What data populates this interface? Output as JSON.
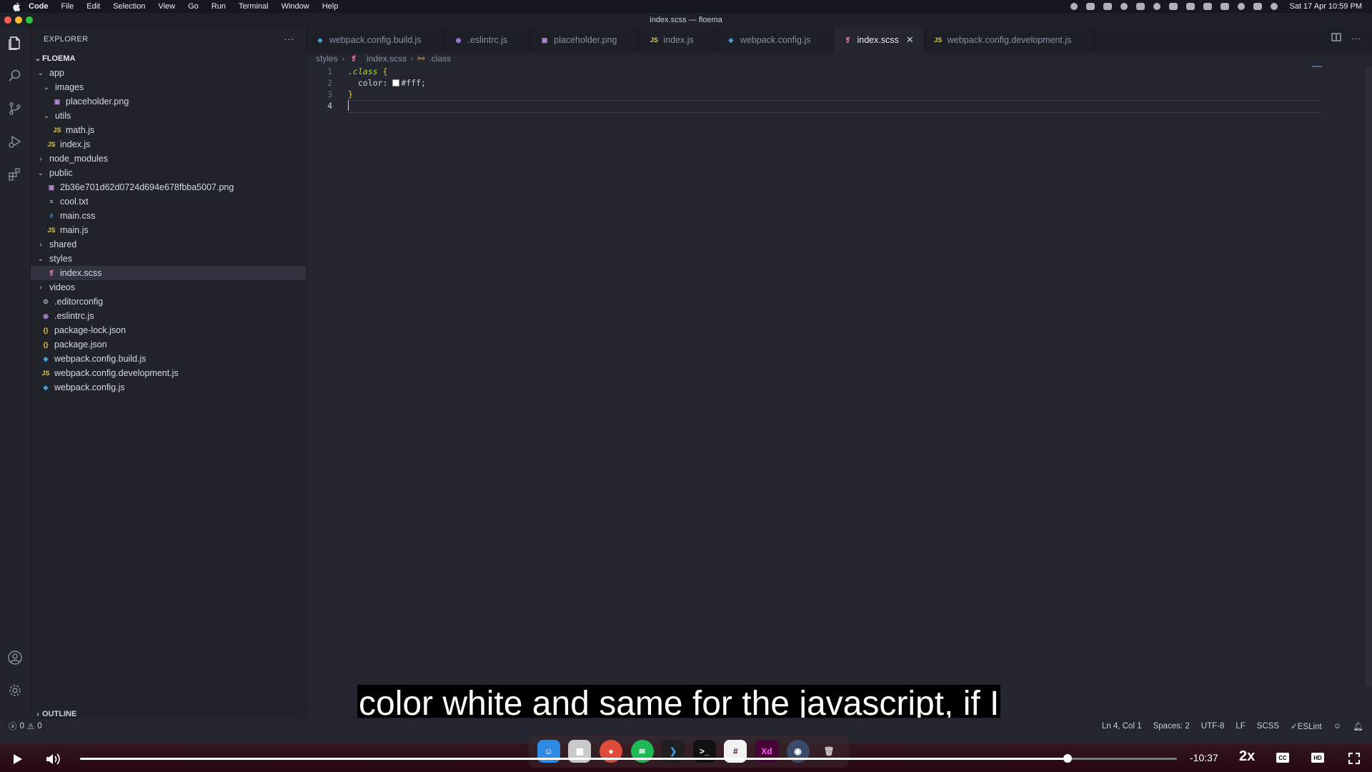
{
  "menubar": {
    "items": [
      "Code",
      "File",
      "Edit",
      "Selection",
      "View",
      "Go",
      "Run",
      "Terminal",
      "Window",
      "Help"
    ],
    "datetime": "Sat 17 Apr  10:59 PM"
  },
  "window": {
    "title": "index.scss — floema"
  },
  "sidebar": {
    "title": "EXPLORER",
    "more": "···",
    "root": "FLOEMA",
    "outline": "OUTLINE",
    "tree": [
      {
        "label": "app",
        "type": "folder",
        "open": true,
        "depth": 0
      },
      {
        "label": "images",
        "type": "folder",
        "open": true,
        "depth": 1
      },
      {
        "label": "placeholder.png",
        "type": "img",
        "depth": 2
      },
      {
        "label": "utils",
        "type": "folder",
        "open": true,
        "depth": 1
      },
      {
        "label": "math.js",
        "type": "js",
        "depth": 2
      },
      {
        "label": "index.js",
        "type": "js",
        "depth": 1
      },
      {
        "label": "node_modules",
        "type": "folder",
        "open": false,
        "depth": 0
      },
      {
        "label": "public",
        "type": "folder",
        "open": true,
        "depth": 0
      },
      {
        "label": "2b36e701d62d0724d694e678fbba5007.png",
        "type": "img",
        "depth": 1
      },
      {
        "label": "cool.txt",
        "type": "txt",
        "depth": 1
      },
      {
        "label": "main.css",
        "type": "css",
        "depth": 1
      },
      {
        "label": "main.js",
        "type": "js",
        "depth": 1
      },
      {
        "label": "shared",
        "type": "folder",
        "open": false,
        "depth": 0
      },
      {
        "label": "styles",
        "type": "folder",
        "open": true,
        "depth": 0
      },
      {
        "label": "index.scss",
        "type": "scss",
        "depth": 1,
        "selected": true
      },
      {
        "label": "videos",
        "type": "folder",
        "open": false,
        "depth": 0
      },
      {
        "label": ".editorconfig",
        "type": "gear",
        "depth": 0
      },
      {
        "label": ".eslintrc.js",
        "type": "eslint",
        "depth": 0
      },
      {
        "label": "package-lock.json",
        "type": "json",
        "depth": 0
      },
      {
        "label": "package.json",
        "type": "json",
        "depth": 0
      },
      {
        "label": "webpack.config.build.js",
        "type": "webpack",
        "depth": 0
      },
      {
        "label": "webpack.config.development.js",
        "type": "js",
        "depth": 0
      },
      {
        "label": "webpack.config.js",
        "type": "webpack",
        "depth": 0
      }
    ]
  },
  "tabs": [
    {
      "label": "webpack.config.build.js",
      "type": "webpack"
    },
    {
      "label": ".eslintrc.js",
      "type": "eslint"
    },
    {
      "label": "placeholder.png",
      "type": "img"
    },
    {
      "label": "index.js",
      "type": "js"
    },
    {
      "label": "webpack.config.js",
      "type": "webpack"
    },
    {
      "label": "index.scss",
      "type": "scss",
      "active": true
    },
    {
      "label": "webpack.config.development.js",
      "type": "js"
    }
  ],
  "breadcrumb": {
    "folder": "styles",
    "file": "index.scss",
    "symbol": ".class"
  },
  "editor": {
    "lines": [
      {
        "num": "1",
        "selector": ".class",
        "brace": "{"
      },
      {
        "num": "2",
        "prop": "color:",
        "value": "#fff;",
        "swatch": "#ffffff"
      },
      {
        "num": "3",
        "brace": "}"
      },
      {
        "num": "4"
      }
    ]
  },
  "statusbar": {
    "errors": "0",
    "warnings": "0",
    "position": "Ln 4, Col 1",
    "spaces": "Spaces: 2",
    "encoding": "UTF-8",
    "eol": "LF",
    "language": "SCSS",
    "linter": "ESLint"
  },
  "subtitle": "color white and same for the javascript, if I",
  "dock": [
    "Finder",
    "Launchpad",
    "Chrome",
    "Spotify",
    "VS Code",
    "Terminal",
    "Slack",
    "Xd",
    "Proxyman",
    "Trash"
  ],
  "player": {
    "progress": 0.9,
    "time_left": "-10:37",
    "speed": "2x",
    "cc": "CC",
    "hd": "HD"
  },
  "colors": {
    "accent_scss": "#e06c9f",
    "js": "#e6c84a",
    "player_bar": "#3a0a14"
  }
}
